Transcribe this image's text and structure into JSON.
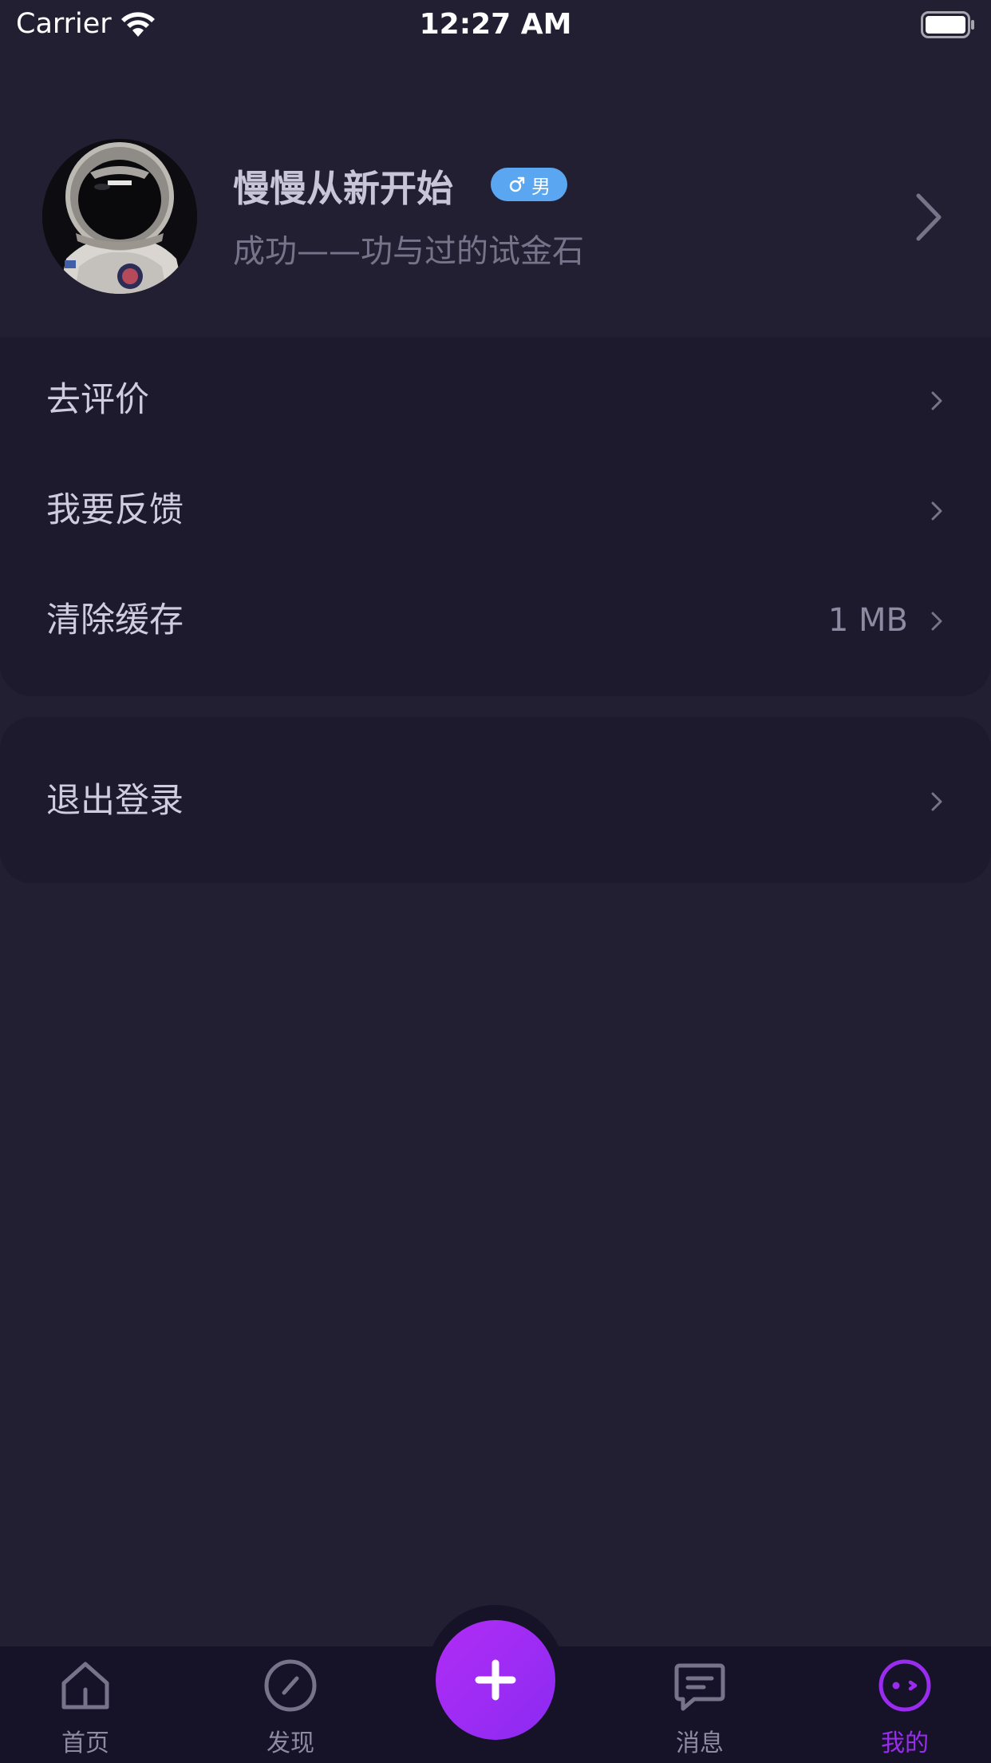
{
  "status_bar": {
    "carrier": "Carrier",
    "time": "12:27 AM",
    "wifi_icon": "wifi-icon",
    "battery_icon": "battery-icon"
  },
  "profile": {
    "username": "慢慢从新开始",
    "gender_symbol": "♂",
    "gender_label": "男",
    "signature": "成功——功与过的试金石",
    "avatar": "astronaut-avatar"
  },
  "menu": {
    "items": [
      {
        "label": "去评价",
        "value": ""
      },
      {
        "label": "我要反馈",
        "value": ""
      },
      {
        "label": "清除缓存",
        "value": "1 MB"
      }
    ],
    "logout_label": "退出登录"
  },
  "tab_bar": {
    "tabs": [
      {
        "label": "首页",
        "icon": "home-icon"
      },
      {
        "label": "发现",
        "icon": "compass-icon"
      },
      {
        "label": "消息",
        "icon": "message-icon"
      },
      {
        "label": "我的",
        "icon": "profile-face-icon"
      }
    ],
    "active_tab": "我的",
    "fab_icon": "plus-icon"
  },
  "colors": {
    "background": "#231f33",
    "card": "#1e1a2d",
    "tab_bar": "#161228",
    "accent": "#9a2cf0",
    "gender_badge": "#5aa6f0"
  }
}
